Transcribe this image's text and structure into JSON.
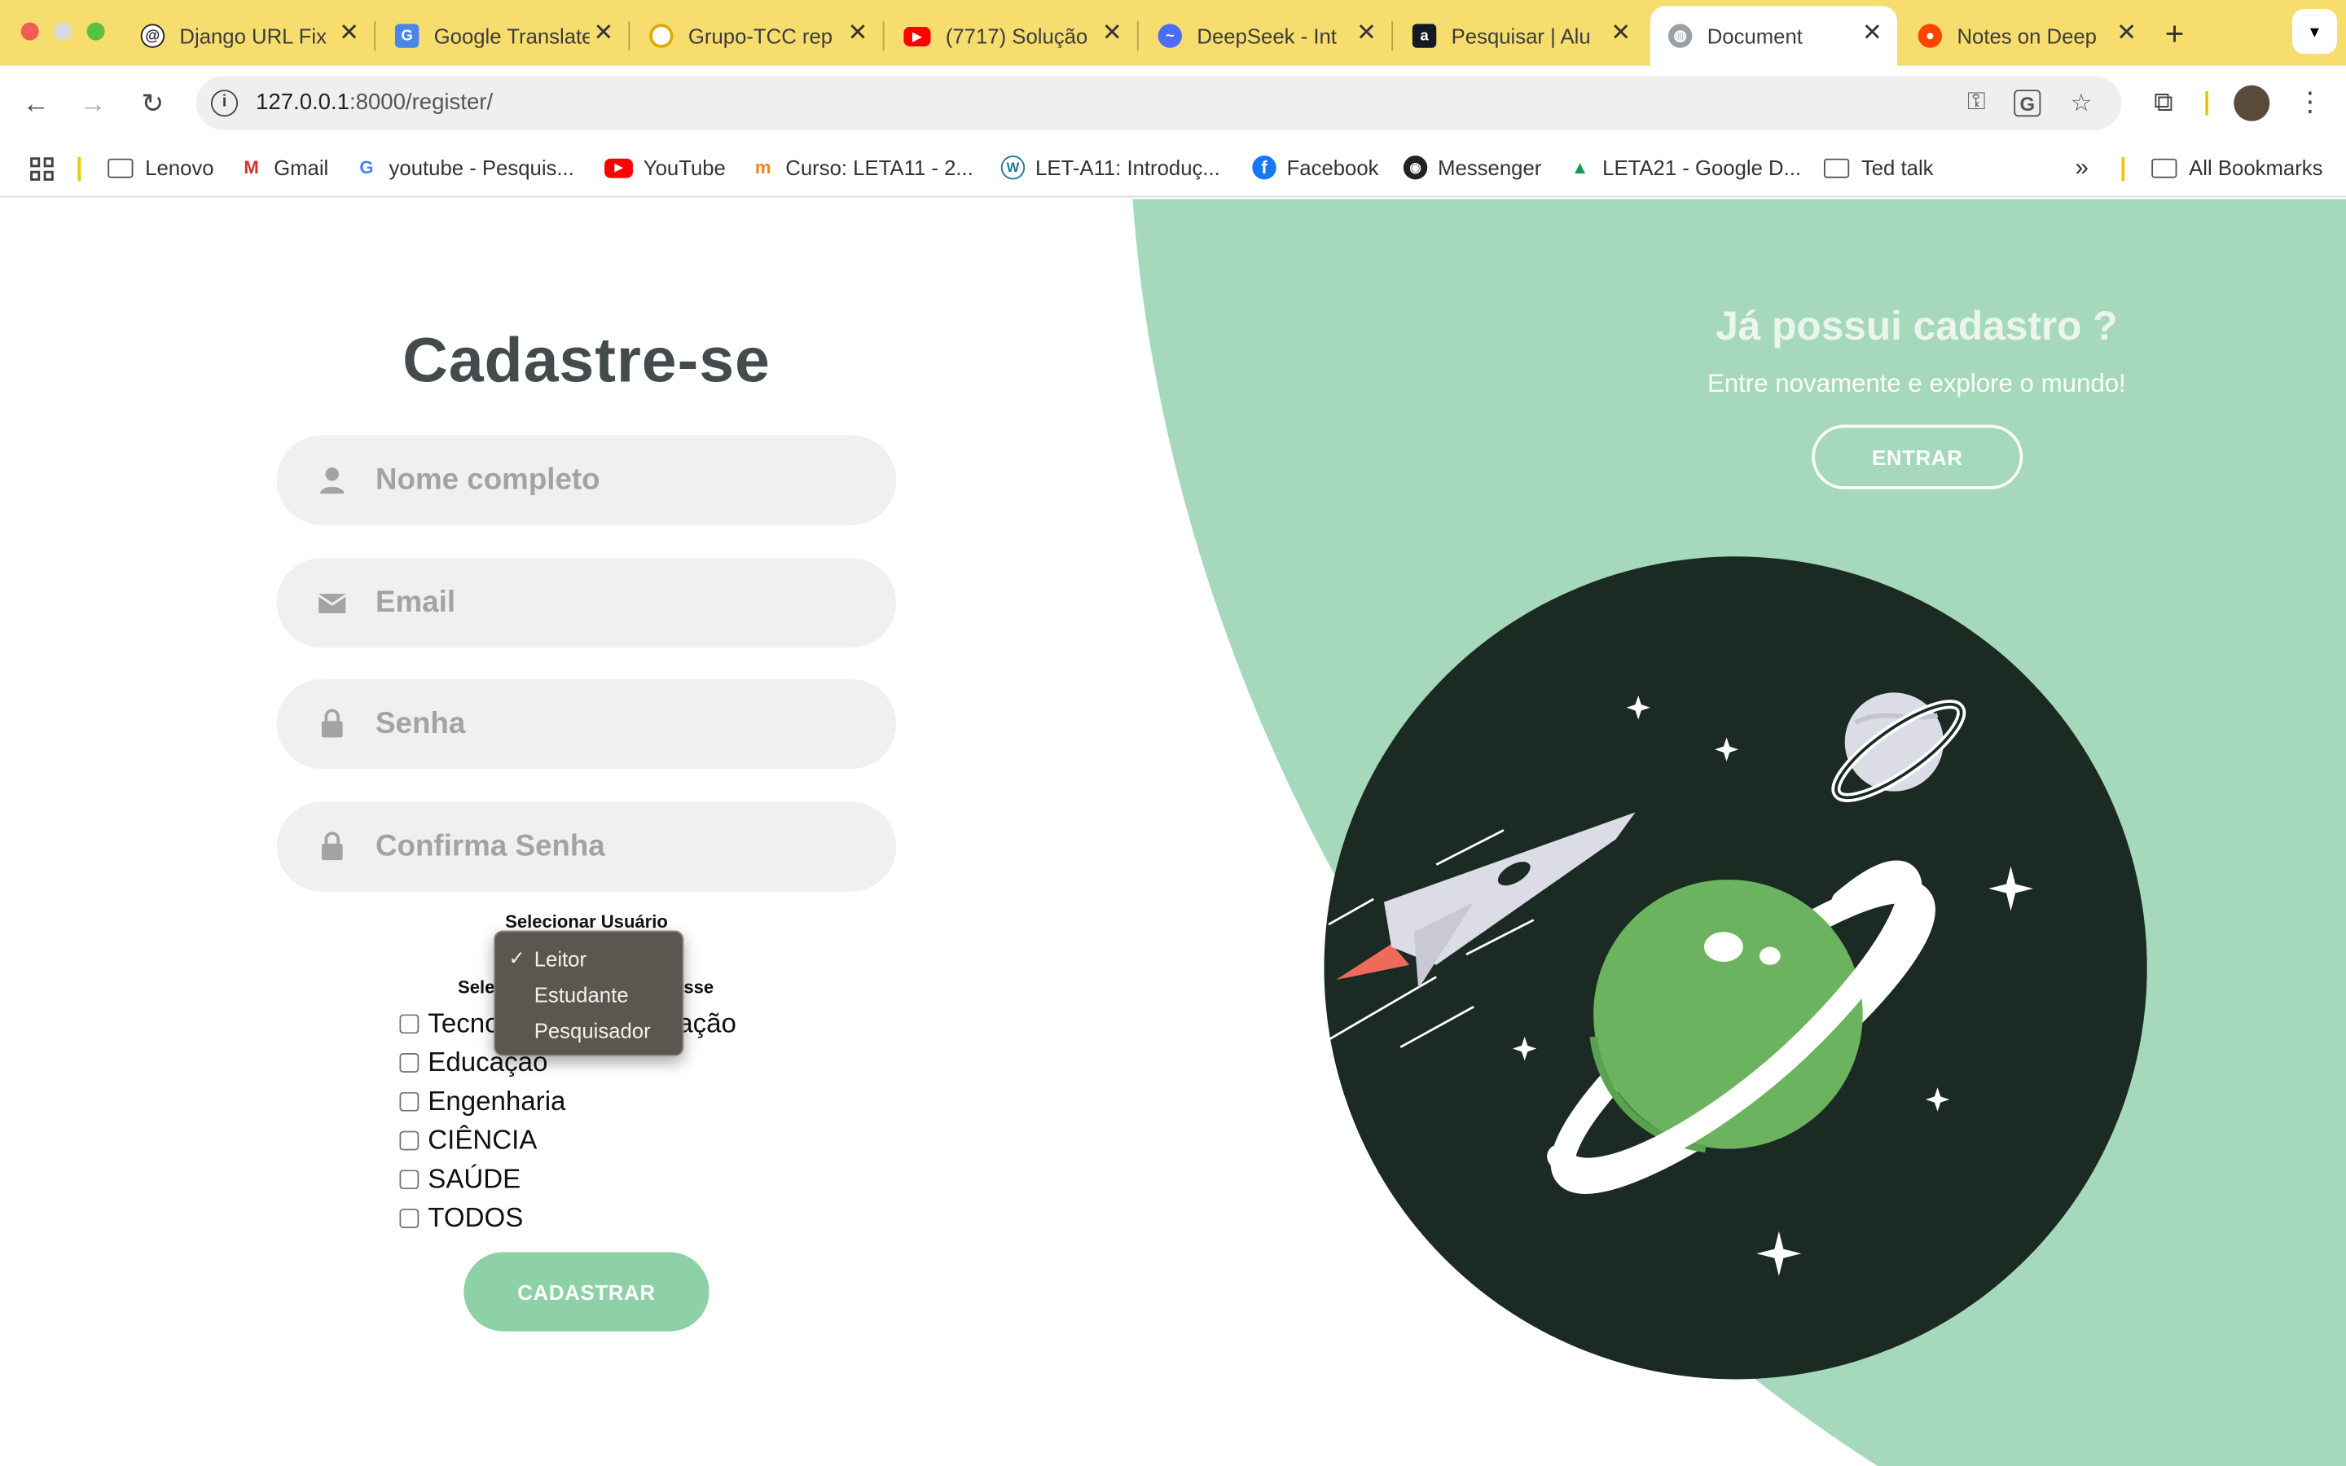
{
  "tabs": [
    {
      "title": "Django URL Fix",
      "icon": "openai-icon"
    },
    {
      "title": "Google Translate",
      "icon": "google-translate-icon"
    },
    {
      "title": "Grupo-TCC rep",
      "icon": "github-icon"
    },
    {
      "title": "(7717) Solução",
      "icon": "youtube-icon"
    },
    {
      "title": "DeepSeek - Int",
      "icon": "deepseek-icon"
    },
    {
      "title": "Pesquisar | Alu",
      "icon": "amazon-icon"
    },
    {
      "title": "Document",
      "icon": "globe-icon"
    },
    {
      "title": "Notes on Deep",
      "icon": "reddit-icon"
    }
  ],
  "address": {
    "host": "127.0.0.1",
    "path": ":8000/register/"
  },
  "bookmarks": [
    {
      "label": "Lenovo",
      "icon": "folder-icon"
    },
    {
      "label": "Gmail",
      "icon": "gmail-icon"
    },
    {
      "label": "youtube - Pesquis...",
      "icon": "google-icon"
    },
    {
      "label": "YouTube",
      "icon": "youtube-icon"
    },
    {
      "label": "Curso: LETA11 - 2...",
      "icon": "moodle-icon"
    },
    {
      "label": "LET-A11: Introduç...",
      "icon": "wordpress-icon"
    },
    {
      "label": "Facebook",
      "icon": "facebook-icon"
    },
    {
      "label": "Messenger",
      "icon": "messenger-icon"
    },
    {
      "label": "LETA21 - Google D...",
      "icon": "google-drive-icon"
    },
    {
      "label": "Ted talk",
      "icon": "folder-icon"
    }
  ],
  "bookmarks_all": "All Bookmarks",
  "form": {
    "title": "Cadastre-se",
    "name_placeholder": "Nome completo",
    "email_placeholder": "Email",
    "password_placeholder": "Senha",
    "confirm_placeholder": "Confirma Senha",
    "select_user_label": "Selecionar Usuário",
    "interest_label_left": "Sele",
    "interest_label_right": "sse",
    "interests": [
      "Tecnologia da Informação",
      "Educação",
      "Engenharia",
      "CIÊNCIA",
      "SAÚDE",
      "TODOS"
    ],
    "submit_label": "CADASTRAR"
  },
  "dropdown": {
    "options": [
      "Leitor",
      "Estudante",
      "Pesquisador"
    ],
    "selected": "Leitor"
  },
  "side": {
    "title": "Já possui cadastro ?",
    "subtitle": "Entre novamente e explore o mundo!",
    "button_label": "ENTRAR"
  },
  "colors": {
    "tabbar": "#f7dd6e",
    "green_panel": "#a6d9bb",
    "dark_circle": "#1b2a22",
    "planet_green": "#6cb35f",
    "button_green": "#8fd1a6"
  }
}
